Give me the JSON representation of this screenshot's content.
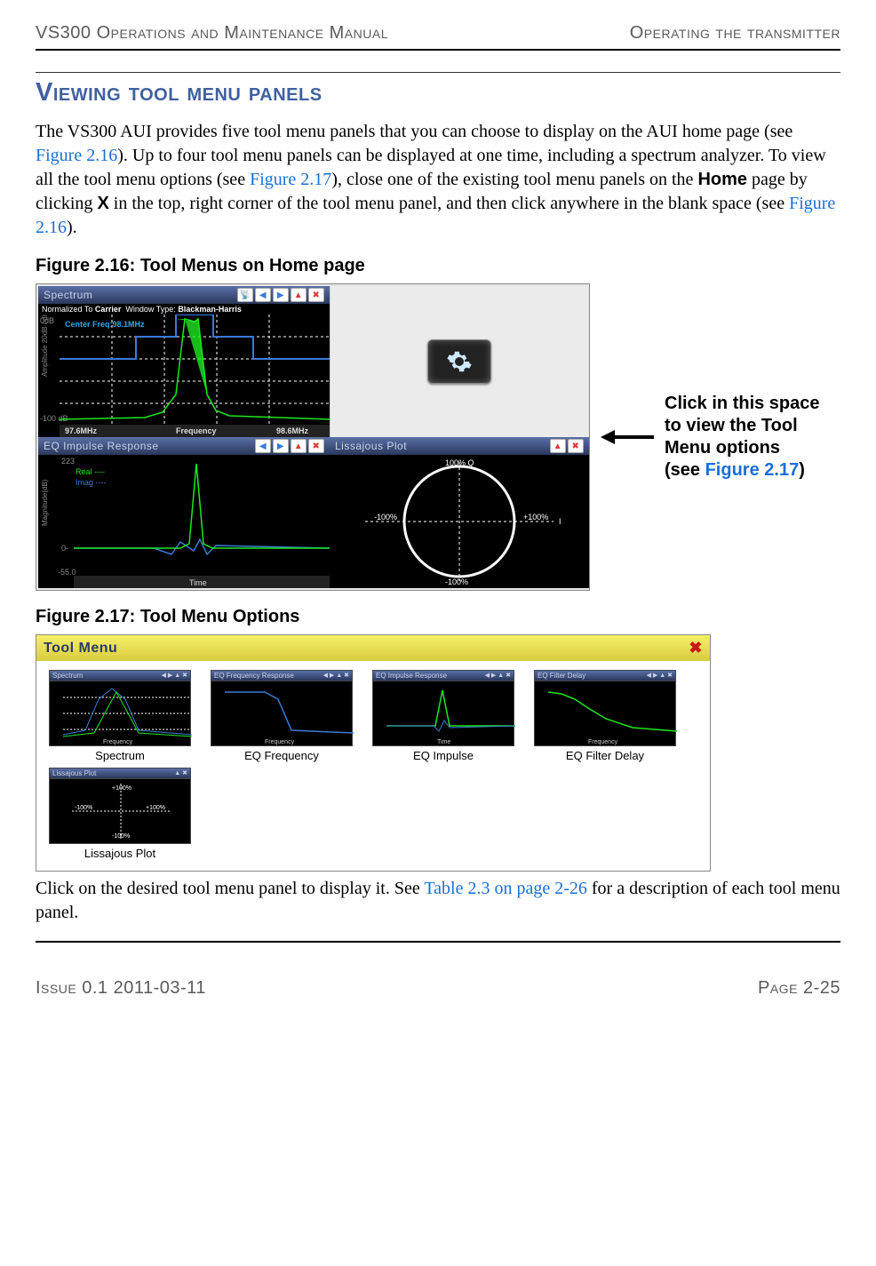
{
  "header": {
    "left": "VS300 Operations and Maintenance Manual",
    "right": "Operating the transmitter"
  },
  "section_heading": "Viewing tool menu panels",
  "paragraph1": {
    "t1": "The VS300 AUI provides five tool menu panels that you can choose to display on the AUI home page (see ",
    "l1": "Figure 2.16",
    "t2": "). Up to four tool menu panels can be displayed at one time, including a spectrum analyzer. To view all the tool menu options (see ",
    "l2": "Figure 2.17",
    "t3": "), close one of the existing tool menu panels on the ",
    "b1": "Home",
    "t4": " page by clicking ",
    "b2": "X",
    "t5": " in the top, right corner of the tool menu panel, and then click anywhere in the blank space (see ",
    "l3": "Figure 2.16",
    "t6": ")."
  },
  "fig216_caption": "Figure 2.16: Tool Menus on Home page",
  "fig216": {
    "spectrum": {
      "title": "Spectrum",
      "norm_label": "Normalized To",
      "norm_val": "Carrier",
      "win_label": "Window Type:",
      "win_val": "Blackman-Harris",
      "center": "Center Freq:98.1MHz",
      "ylabel": "Amplitude 20dB / div",
      "ytop": "0dB",
      "ybot": "-100 dB",
      "xlabel": "Frequency",
      "xleft": "97.6MHz",
      "xright": "98.6MHz"
    },
    "eq": {
      "title": "EQ Impulse Response",
      "real": "Real ----",
      "imag": "Imag ----",
      "ylabel": "Magnitude(dB)",
      "ytop": "223",
      "ymid": "0-",
      "ybot": "-55.0",
      "xlabel": "Time"
    },
    "lissa": {
      "title": "Lissajous Plot",
      "top": "100% Q",
      "bot": "-100%",
      "left": "-100%",
      "right": "+100%",
      "i": "I"
    }
  },
  "callout": {
    "l1": "Click in this space",
    "l2": "to view the Tool",
    "l3": "Menu options",
    "l4a": "(see ",
    "l4b": "Figure 2.17",
    "l4c": ")"
  },
  "fig217_caption": "Figure 2.17: Tool Menu Options",
  "fig217": {
    "title": "Tool Menu",
    "items": [
      "Spectrum",
      "EQ Frequency",
      "EQ Impulse",
      "EQ Filter Delay",
      "Lissajous Plot"
    ],
    "thumb_titles": [
      "Spectrum",
      "EQ Frequency Response",
      "EQ Impulse Response",
      "EQ Filter Delay",
      "Lissajous Plot"
    ]
  },
  "paragraph2": {
    "t1": "Click on the desired tool menu panel to display it. See ",
    "l1": "Table 2.3 on page 2-26",
    "t2": " for a description of each tool menu panel."
  },
  "footer": {
    "left": "Issue 0.1  2011-03-11",
    "right": "Page 2-25"
  }
}
